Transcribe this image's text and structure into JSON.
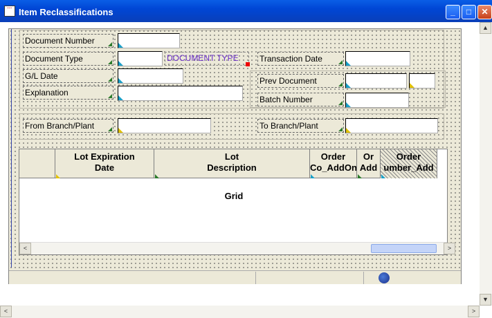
{
  "window": {
    "title": "Item Reclassifications"
  },
  "titlebar_buttons": {
    "minimize": "_",
    "maximize": "□",
    "close": "✕"
  },
  "header": {
    "document_number_label": "Document Number",
    "document_type_label": "Document Type",
    "document_type_value": "DOCUMENT TYPE",
    "gl_date_label": "G/L Date",
    "explanation_label": "Explanation",
    "transaction_date_label": "Transaction Date",
    "prev_document_label": "Prev Document",
    "batch_number_label": "Batch Number",
    "from_branch_label": "From Branch/Plant",
    "to_branch_label": "To Branch/Plant"
  },
  "grid": {
    "label": "Grid",
    "columns": [
      {
        "line1": "",
        "line2": ""
      },
      {
        "line1": "Lot Expiration",
        "line2": "Date"
      },
      {
        "line1": "Lot",
        "line2": "Description"
      },
      {
        "line1": "Order",
        "line2": "Co_AddOn"
      },
      {
        "line1": "Or",
        "line2": "Add"
      },
      {
        "line1": "Order",
        "line2": "umber_Add"
      }
    ]
  },
  "scroll": {
    "left": "<",
    "right": ">",
    "up": "▲",
    "down": "▼",
    "grip": "|||"
  },
  "colors": {
    "titlebar": "#0046d5",
    "form_bg": "#ece9d8",
    "accent_cyan": "#1aa0c8",
    "accent_yellow": "#e0c000",
    "doctype_text": "#6a2fc8"
  },
  "icons": {
    "app": "app-icon",
    "status": "globe-icon"
  }
}
